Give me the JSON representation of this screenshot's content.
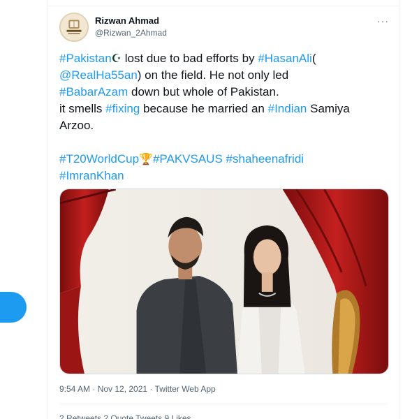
{
  "tweet": {
    "author_name": "Rizwan Ahmad",
    "author_handle": "@Rizwan_2Ahmad",
    "more_label": "···",
    "lines": [
      [
        {
          "t": "#Pakistan",
          "tag": true
        },
        {
          "t": "☪",
          "emoji": "flag"
        },
        {
          "t": " lost due to bad efforts by ",
          "tag": false
        },
        {
          "t": "#HasanAli",
          "tag": true
        },
        {
          "t": "(",
          "tag": false
        }
      ],
      [
        {
          "t": "@RealHa55an",
          "tag": true
        },
        {
          "t": ") on the field. He not only led",
          "tag": false
        }
      ],
      [
        {
          "t": "#BabarAzam",
          "tag": true
        },
        {
          "t": " down but whole of Pakistan.",
          "tag": false
        }
      ],
      [
        {
          "t": "it smells ",
          "tag": false
        },
        {
          "t": "#fixing",
          "tag": true
        },
        {
          "t": " because he married an ",
          "tag": false
        },
        {
          "t": "#Indian",
          "tag": true
        },
        {
          "t": " Samiya",
          "tag": false
        }
      ],
      [
        {
          "t": "Arzoo.",
          "tag": false
        }
      ],
      [],
      [
        {
          "t": "#T20WorldCup",
          "tag": true
        },
        {
          "t": " 🏆 ",
          "emoji": "trophy"
        },
        {
          "t": "#PAKVSAUS",
          "tag": true
        },
        {
          "t": " ",
          "tag": false
        },
        {
          "t": "#shaheenafridi",
          "tag": true
        }
      ],
      [
        {
          "t": "#ImranKhan",
          "tag": true
        }
      ]
    ],
    "timestamp_line": "9:54 AM · Nov 12, 2021 · Twitter Web App",
    "stats_line": "2 Retweets   2 Quote Tweets   9 Likes"
  },
  "colors": {
    "link": "#1d9bf0",
    "text": "#0f1419",
    "muted": "#536471"
  }
}
